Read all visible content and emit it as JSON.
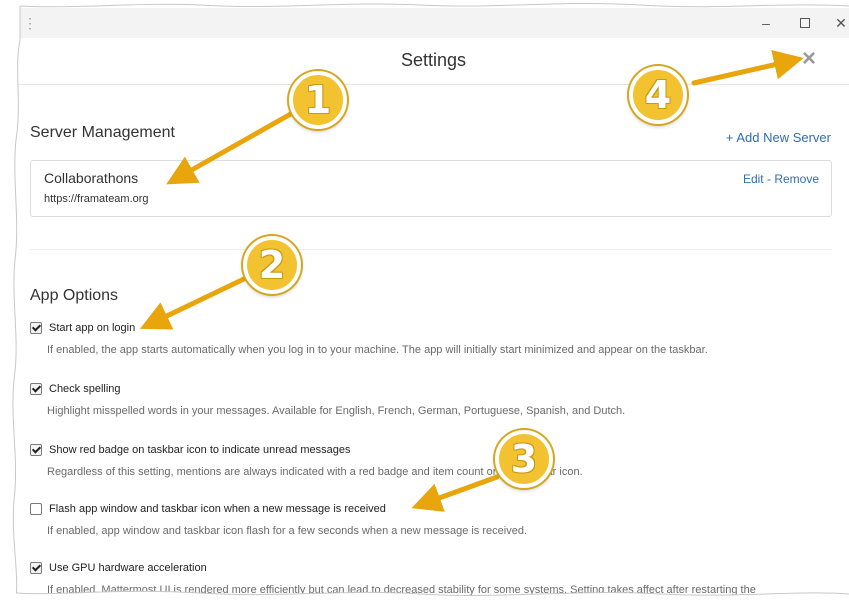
{
  "window": {
    "menu_icon": "⋮",
    "minimize": "–",
    "close": "✕"
  },
  "modal": {
    "title": "Settings",
    "close_icon": "×"
  },
  "server_management": {
    "title": "Server Management",
    "add_link": "+ Add New Server",
    "servers": [
      {
        "name": "Collaborathons",
        "url": "https://framateam.org",
        "edit": "Edit",
        "separator": " - ",
        "remove": "Remove"
      }
    ]
  },
  "app_options": {
    "title": "App Options",
    "options": [
      {
        "label": "Start app on login",
        "checked": true,
        "help": "If enabled, the app starts automatically when you log in to your machine. The app will initially start minimized and appear on the taskbar."
      },
      {
        "label": "Check spelling",
        "checked": true,
        "help": "Highlight misspelled words in your messages. Available for English, French, German, Portuguese, Spanish, and Dutch."
      },
      {
        "label": "Show red badge on taskbar icon to indicate unread messages",
        "checked": true,
        "help": "Regardless of this setting, mentions are always indicated with a red badge and item count on the taskbar icon."
      },
      {
        "label": "Flash app window and taskbar icon when a new message is received",
        "checked": false,
        "help": "If enabled, app window and taskbar icon flash for a few seconds when a new message is received."
      },
      {
        "label": "Use GPU hardware acceleration",
        "checked": true,
        "help": "If enabled, Mattermost UI is rendered more efficiently but can lead to decreased stability for some systems. Setting takes affect after restarting the"
      }
    ]
  },
  "annotations": {
    "badges": [
      "1",
      "2",
      "3",
      "4"
    ],
    "color": "#e8a50c"
  }
}
